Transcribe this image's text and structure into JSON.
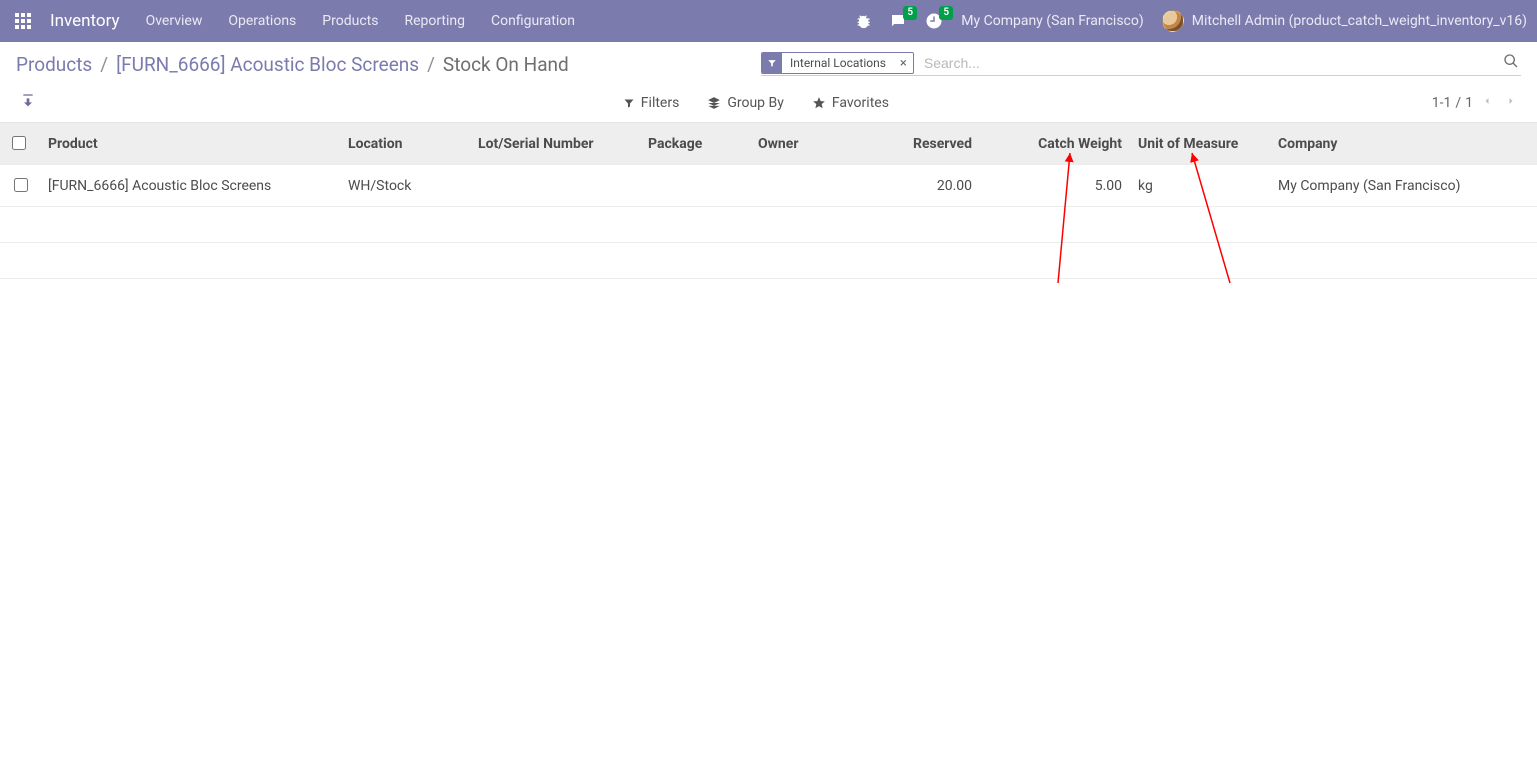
{
  "nav": {
    "brand": "Inventory",
    "menu": [
      "Overview",
      "Operations",
      "Products",
      "Reporting",
      "Configuration"
    ],
    "messages_badge": "5",
    "activities_badge": "5",
    "company": "My Company (San Francisco)",
    "user": "Mitchell Admin (product_catch_weight_inventory_v16)"
  },
  "breadcrumb": {
    "product_root": "Products",
    "product_name": "[FURN_6666] Acoustic Bloc Screens",
    "current": "Stock On Hand"
  },
  "search": {
    "facet_label": "Internal Locations",
    "placeholder": "Search..."
  },
  "tools": {
    "filters": "Filters",
    "group_by": "Group By",
    "favorites": "Favorites"
  },
  "pager": {
    "range": "1-1",
    "sep": "/",
    "total": "1"
  },
  "table": {
    "headers": {
      "product": "Product",
      "location": "Location",
      "lot": "Lot/Serial Number",
      "package": "Package",
      "owner": "Owner",
      "reserved": "Reserved",
      "catch_weight": "Catch Weight",
      "uom": "Unit of Measure",
      "company": "Company"
    },
    "rows": [
      {
        "product": "[FURN_6666] Acoustic Bloc Screens",
        "location": "WH/Stock",
        "lot": "",
        "package": "",
        "owner": "",
        "reserved": "20.00",
        "catch_weight": "5.00",
        "uom": "kg",
        "company": "My Company (San Francisco)"
      }
    ]
  }
}
